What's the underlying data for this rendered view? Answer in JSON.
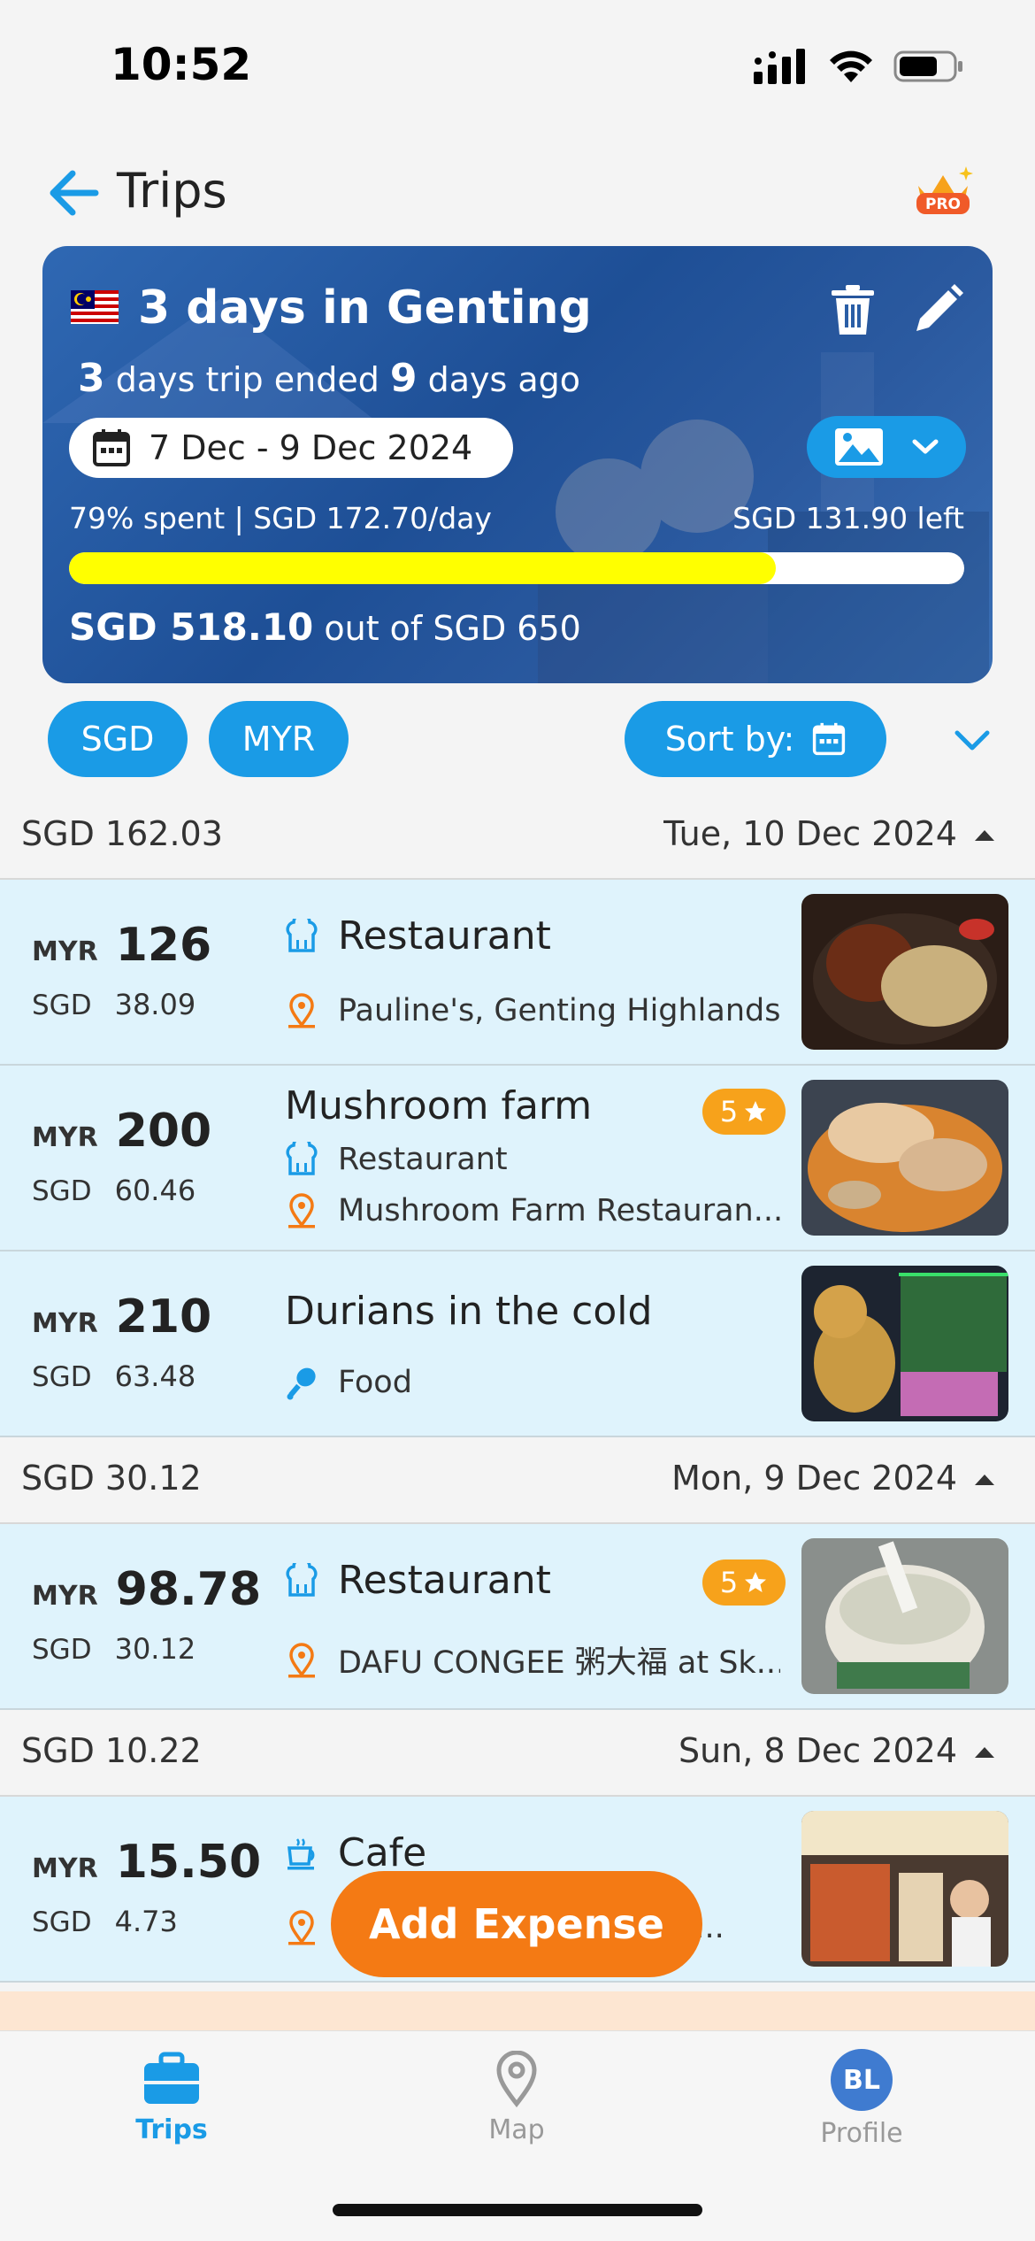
{
  "status": {
    "time": "10:52"
  },
  "header": {
    "title": "Trips",
    "pro_label": "PRO"
  },
  "trip": {
    "title": "3 days in Genting",
    "sub_days": "3",
    "sub_mid": " days trip ended ",
    "sub_ago": "9",
    "sub_end": " days ago",
    "date_range": "7 Dec - 9 Dec 2024",
    "stats": "79% spent | SGD 172.70/day",
    "left": "SGD 131.90 left",
    "progress": 0.79,
    "total_spent": "SGD 518.10",
    "total_rest": " out of SGD 650"
  },
  "filters": {
    "currency1": "SGD",
    "currency2": "MYR",
    "sort_label": "Sort by:"
  },
  "days": [
    {
      "total": "SGD 162.03",
      "date": "Tue, 10 Dec 2024"
    },
    {
      "total": "SGD 30.12",
      "date": "Mon, 9 Dec 2024"
    },
    {
      "total": "SGD 10.22",
      "date": "Sun, 8 Dec 2024"
    }
  ],
  "expenses": [
    {
      "cur": "MYR",
      "amount": "126",
      "sgd_cur": "SGD",
      "sgd": "38.09",
      "title": "Restaurant",
      "location": "Pauline's, Genting Highlands,..."
    },
    {
      "cur": "MYR",
      "amount": "200",
      "sgd_cur": "SGD",
      "sgd": "60.46",
      "title": "Mushroom farm",
      "category": "Restaurant",
      "location": "Mushroom Farm Restauran...",
      "rating": "5"
    },
    {
      "cur": "MYR",
      "amount": "210",
      "sgd_cur": "SGD",
      "sgd": "63.48",
      "title": "Durians in the cold",
      "category": "Food"
    },
    {
      "cur": "MYR",
      "amount": "98.78",
      "sgd_cur": "SGD",
      "sgd": "30.12",
      "title": "Restaurant",
      "location": "DAFU CONGEE 粥大福 at Sk...",
      "rating": "5"
    },
    {
      "cur": "MYR",
      "amount": "15.50",
      "sgd_cur": "SGD",
      "sgd": "4.73",
      "title": "Cafe",
      "location": "lan..."
    }
  ],
  "add_expense": "Add Expense",
  "tabs": {
    "trips": "Trips",
    "map": "Map",
    "profile": "Profile",
    "avatar": "BL"
  },
  "colors": {
    "accent": "#1a9be6",
    "orange": "#f47a14",
    "row_bg": "#dff3fc",
    "progress": "#ffff00"
  }
}
